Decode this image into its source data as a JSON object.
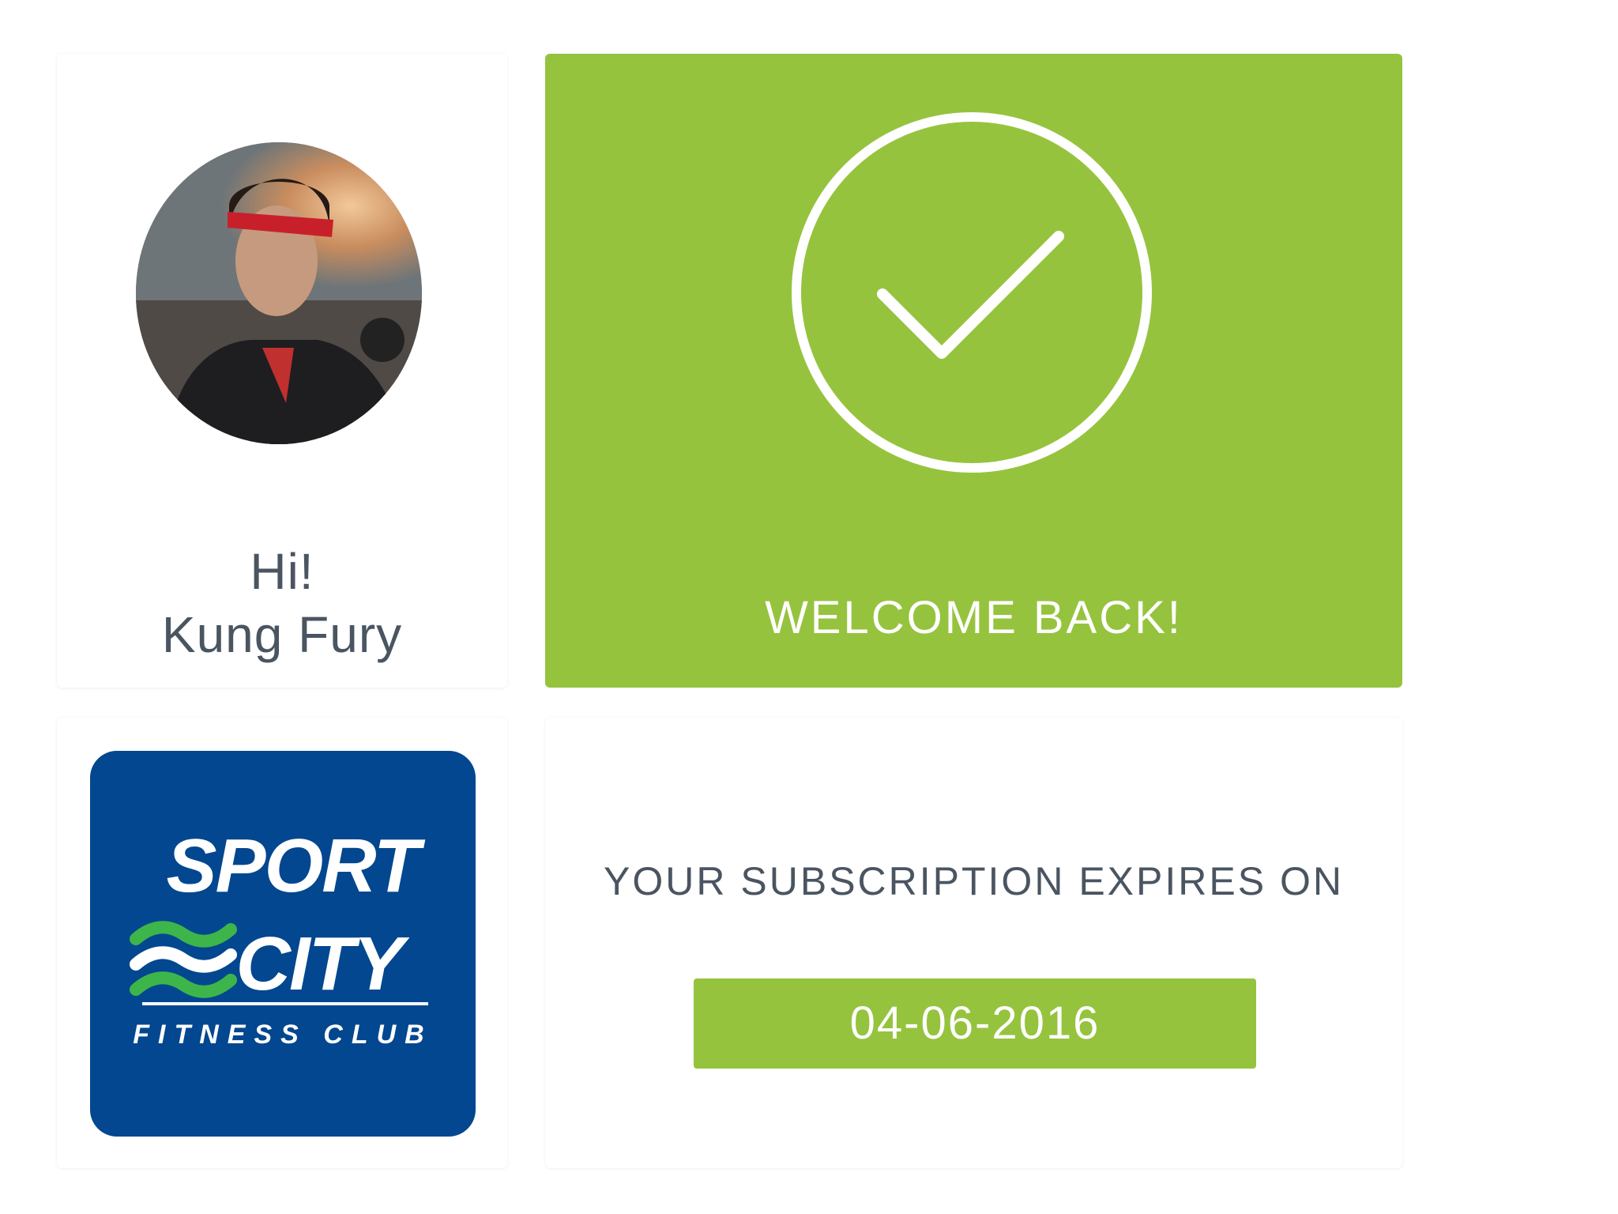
{
  "profile": {
    "greeting": "Hi!",
    "name": "Kung Fury",
    "avatar_icon": "user-avatar-photo"
  },
  "welcome": {
    "message": "WELCOME BACK!",
    "icon": "check-circle-icon",
    "background_color": "#96c33e"
  },
  "logo": {
    "line1": "SPORT",
    "line2": "CITY",
    "tagline": "FITNESS CLUB",
    "background_color": "#02478f",
    "accent_color": "#3db54a"
  },
  "subscription": {
    "label": "YOUR SUBSCRIPTION EXPIRES ON",
    "expiry_date": "04-06-2016"
  },
  "colors": {
    "accent": "#96c33e",
    "text": "#4a5561",
    "brand_blue": "#02478f"
  }
}
